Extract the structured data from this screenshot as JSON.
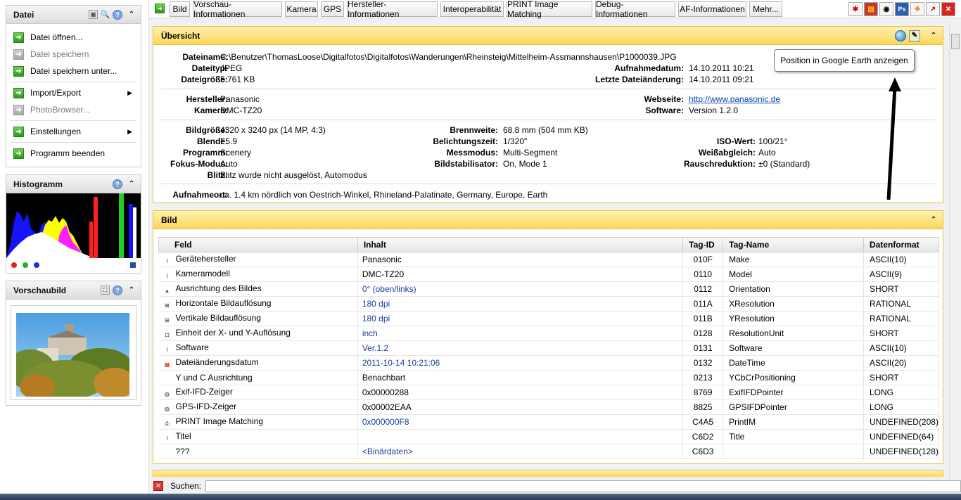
{
  "sidebar": {
    "datei": {
      "title": "Datei",
      "items": [
        {
          "label": "Datei öffnen...",
          "enabled": true
        },
        {
          "label": "Datei speichern",
          "enabled": false
        },
        {
          "label": "Datei speichern unter...",
          "enabled": true
        },
        {
          "label": "Import/Export",
          "enabled": true
        },
        {
          "label": "PhotoBrowser...",
          "enabled": false
        },
        {
          "label": "Einstellungen",
          "enabled": true
        },
        {
          "label": "Programm beenden",
          "enabled": true
        }
      ]
    },
    "histogramm": {
      "title": "Histogramm"
    },
    "vorschau": {
      "title": "Vorschaubild"
    }
  },
  "toolbar": {
    "tabs": [
      "Bild",
      "Vorschau-Informationen",
      "Kamera",
      "GPS",
      "Hersteller-Informationen",
      "Interoperabilität",
      "PRINT Image Matching",
      "Debug-Informationen",
      "AF-Informationen",
      "Mehr..."
    ]
  },
  "overview": {
    "title": "Übersicht",
    "dateiname_label": "Dateiname:",
    "dateiname": "C:\\Benutzer\\ThomasLoose\\Digitalfotos\\Digitalfotos\\Wanderungen\\Rheinsteig\\Mittelheim-Assmannshausen\\P1000039.JPG",
    "dateityp_label": "Dateityp:",
    "dateityp": "JPEG",
    "dateigroesse_label": "Dateigröße:",
    "dateigroesse": "5.761 KB",
    "aufnahmedatum_label": "Aufnahmedatum:",
    "aufnahmedatum": "14.10.2011 10:21",
    "letzte_label": "Letzte Dateiänderung:",
    "letzte": "14.10.2011 09:21",
    "hersteller_label": "Hersteller:",
    "hersteller": "Panasonic",
    "kamera_label": "Kamera:",
    "kamera": "DMC-TZ20",
    "webseite_label": "Webseite:",
    "webseite": "http://www.panasonic.de",
    "software_label": "Software:",
    "software": "Version 1.2.0",
    "bildgroesse_label": "Bildgröße:",
    "bildgroesse": "4320 x 3240 px (14 MP, 4:3)",
    "blende_label": "Blende:",
    "blende": "F5.9",
    "programm_label": "Programm:",
    "programm": "Scenery",
    "fokus_label": "Fokus-Modus:",
    "fokus": "Auto",
    "blitz_label": "Blitz:",
    "blitz": "Blitz wurde nicht ausgelöst, Automodus",
    "brennweite_label": "Brennweite:",
    "brennweite": "68.8 mm (504 mm KB)",
    "belichtung_label": "Belichtungszeit:",
    "belichtung": "1/320\"",
    "messmodus_label": "Messmodus:",
    "messmodus": "Multi-Segment",
    "stabilisator_label": "Bildstabilisator:",
    "stabilisator": "On, Mode 1",
    "iso_label": "ISO-Wert:",
    "iso": "100/21°",
    "weiss_label": "Weißabgleich:",
    "weiss": "Auto",
    "rausch_label": "Rauschreduktion:",
    "rausch": "±0 (Standard)",
    "ort_label": "Aufnahmeort:",
    "ort": "ca. 1.4 km nördlich von Oestrich-Winkel, Rhineland-Palatinate, Germany, Europe, Earth",
    "tooltip": "Position in Google Earth anzeigen"
  },
  "bild": {
    "title": "Bild",
    "columns": [
      "Feld",
      "Inhalt",
      "Tag-ID",
      "Tag-Name",
      "Datenformat"
    ],
    "rows": [
      {
        "icon": "text-icon",
        "feld": "Gerätehersteller",
        "inhalt": "Panasonic",
        "tag": "010F",
        "name": "Make",
        "format": "ASCII(10)",
        "blue": false
      },
      {
        "icon": "text-icon",
        "feld": "Kameramodell",
        "inhalt": "DMC-TZ20",
        "tag": "0110",
        "name": "Model",
        "format": "ASCII(9)",
        "blue": false
      },
      {
        "icon": "orientation-icon",
        "feld": "Ausrichtung des Bildes",
        "inhalt": "0° (oben/links)",
        "tag": "0112",
        "name": "Orientation",
        "format": "SHORT",
        "blue": true
      },
      {
        "icon": "resolution-icon",
        "feld": "Horizontale Bildauflösung",
        "inhalt": "180 dpi",
        "tag": "011A",
        "name": "XResolution",
        "format": "RATIONAL",
        "blue": true
      },
      {
        "icon": "resolution-icon",
        "feld": "Vertikale Bildauflösung",
        "inhalt": "180 dpi",
        "tag": "011B",
        "name": "YResolution",
        "format": "RATIONAL",
        "blue": true
      },
      {
        "icon": "unit-icon",
        "feld": "Einheit der X- und Y-Auflösung",
        "inhalt": "inch",
        "tag": "0128",
        "name": "ResolutionUnit",
        "format": "SHORT",
        "blue": true
      },
      {
        "icon": "text-icon",
        "feld": "Software",
        "inhalt": "Ver.1.2",
        "tag": "0131",
        "name": "Software",
        "format": "ASCII(10)",
        "blue": true
      },
      {
        "icon": "calendar-icon",
        "feld": "Dateiänderungsdatum",
        "inhalt": "2011-10-14 10:21:06",
        "tag": "0132",
        "name": "DateTime",
        "format": "ASCII(20)",
        "blue": true
      },
      {
        "icon": "none",
        "feld": "Y und C Ausrichtung",
        "inhalt": "Benachbart",
        "tag": "0213",
        "name": "YCbCrPositioning",
        "format": "SHORT",
        "blue": false
      },
      {
        "icon": "camera-icon",
        "feld": "Exif-IFD-Zeiger",
        "inhalt": "0x00000288",
        "tag": "8769",
        "name": "ExifIFDPointer",
        "format": "LONG",
        "blue": false
      },
      {
        "icon": "camera-icon",
        "feld": "GPS-IFD-Zeiger",
        "inhalt": "0x00002EAA",
        "tag": "8825",
        "name": "GPSIFDPointer",
        "format": "LONG",
        "blue": false
      },
      {
        "icon": "printer-icon",
        "feld": "PRINT Image Matching",
        "inhalt": "0x000000F8",
        "tag": "C4A5",
        "name": "PrintIM",
        "format": "UNDEFINED(208)",
        "blue": true
      },
      {
        "icon": "text-icon",
        "feld": "Titel",
        "inhalt": "",
        "tag": "C6D2",
        "name": "Title",
        "format": "UNDEFINED(64)",
        "blue": false
      },
      {
        "icon": "none",
        "feld": "???",
        "inhalt": "<Binärdaten>",
        "tag": "C6D3",
        "name": "",
        "format": "UNDEFINED(128)",
        "blue": true
      }
    ]
  },
  "search": {
    "label": "Suchen:",
    "value": ""
  }
}
